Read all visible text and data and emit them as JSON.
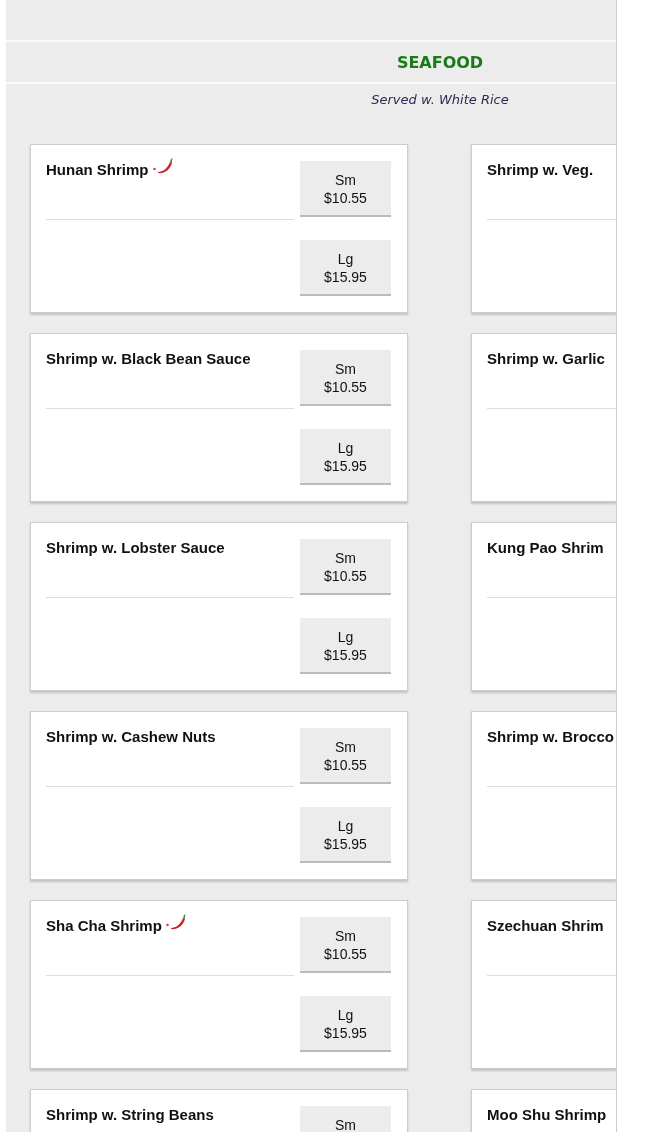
{
  "section": {
    "title": "SEAFOOD",
    "subtitle": "Served w. White Rice"
  },
  "rows": [
    {
      "left": {
        "name": "Hunan Shrimp",
        "spicy": true,
        "prices": [
          {
            "size": "Sm",
            "price": "$10.55"
          },
          {
            "size": "Lg",
            "price": "$15.95"
          }
        ]
      },
      "right": {
        "name": "Shrimp w. Veg.",
        "spicy": false
      }
    },
    {
      "left": {
        "name": "Shrimp w. Black Bean Sauce",
        "spicy": false,
        "prices": [
          {
            "size": "Sm",
            "price": "$10.55"
          },
          {
            "size": "Lg",
            "price": "$15.95"
          }
        ]
      },
      "right": {
        "name": "Shrimp w. Garlic",
        "spicy": false
      }
    },
    {
      "left": {
        "name": "Shrimp w. Lobster Sauce",
        "spicy": false,
        "prices": [
          {
            "size": "Sm",
            "price": "$10.55"
          },
          {
            "size": "Lg",
            "price": "$15.95"
          }
        ]
      },
      "right": {
        "name": "Kung Pao Shrim",
        "spicy": false
      }
    },
    {
      "left": {
        "name": "Shrimp w. Cashew Nuts",
        "spicy": false,
        "prices": [
          {
            "size": "Sm",
            "price": "$10.55"
          },
          {
            "size": "Lg",
            "price": "$15.95"
          }
        ]
      },
      "right": {
        "name": "Shrimp w. Brocco",
        "spicy": false
      }
    },
    {
      "left": {
        "name": "Sha Cha Shrimp",
        "spicy": true,
        "prices": [
          {
            "size": "Sm",
            "price": "$10.55"
          },
          {
            "size": "Lg",
            "price": "$15.95"
          }
        ]
      },
      "right": {
        "name": "Szechuan Shrim",
        "spicy": false
      }
    },
    {
      "left": {
        "name": "Shrimp w. String Beans",
        "spicy": false,
        "prices": [
          {
            "size": "Sm"
          }
        ]
      },
      "right": {
        "name": "Moo Shu Shrimp",
        "spicy": false
      }
    }
  ]
}
